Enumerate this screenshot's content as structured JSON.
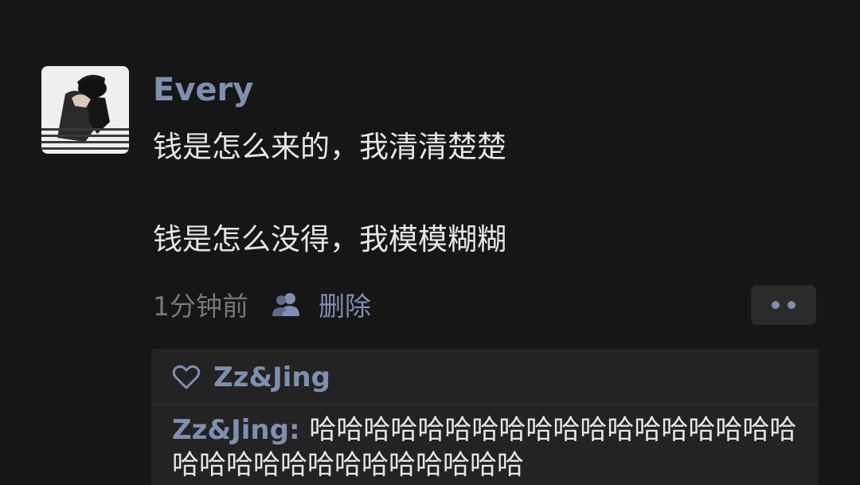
{
  "post": {
    "author": "Every",
    "lines": [
      "钱是怎么来的，我清清楚楚",
      "钱是怎么没得，我模模糊糊"
    ],
    "time": "1分钟前",
    "delete_label": "删除"
  },
  "icons": {
    "avatar": "profile-photo",
    "privacy": "people-icon",
    "more": "more-dots-icon",
    "like": "heart-icon"
  },
  "likes": {
    "names": "Zz&Jing"
  },
  "comments": [
    {
      "author": "Zz&Jing",
      "separator": ": ",
      "text": "哈哈哈哈哈哈哈哈哈哈哈哈哈哈哈哈哈哈哈哈哈哈哈哈哈哈哈哈哈哈哈"
    }
  ],
  "colors": {
    "background": "#161616",
    "link": "#7f8fb0",
    "text": "#e6e6e6",
    "muted": "#777777",
    "panel": "#232323"
  }
}
